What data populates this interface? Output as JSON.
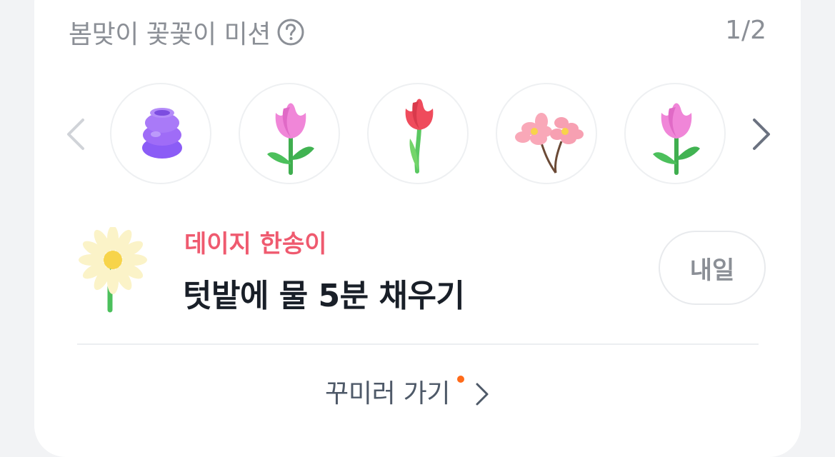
{
  "header": {
    "title": "봄맞이 꽃꽃이 미션",
    "help_icon": "question-circle-icon",
    "page_indicator": "1/2"
  },
  "carousel": {
    "prev_icon": "chevron-left-icon",
    "next_icon": "chevron-right-icon",
    "items": [
      {
        "icon": "purple-vase-icon"
      },
      {
        "icon": "pink-tulip-icon"
      },
      {
        "icon": "red-tulip-icon"
      },
      {
        "icon": "cherry-blossom-icon"
      },
      {
        "icon": "pink-tulip-icon"
      }
    ]
  },
  "mission": {
    "icon": "daisy-icon",
    "tag": "데이지 한송이",
    "text": "텃밭에 물 5분 채우기",
    "button_label": "내일"
  },
  "footer": {
    "link_label": "꾸미러 가기",
    "chevron_icon": "chevron-right-icon"
  },
  "colors": {
    "accent_tag": "#ef5a6f",
    "new_dot": "#ff6b1a",
    "muted_text": "#8b8f96",
    "primary_text": "#191f28"
  }
}
